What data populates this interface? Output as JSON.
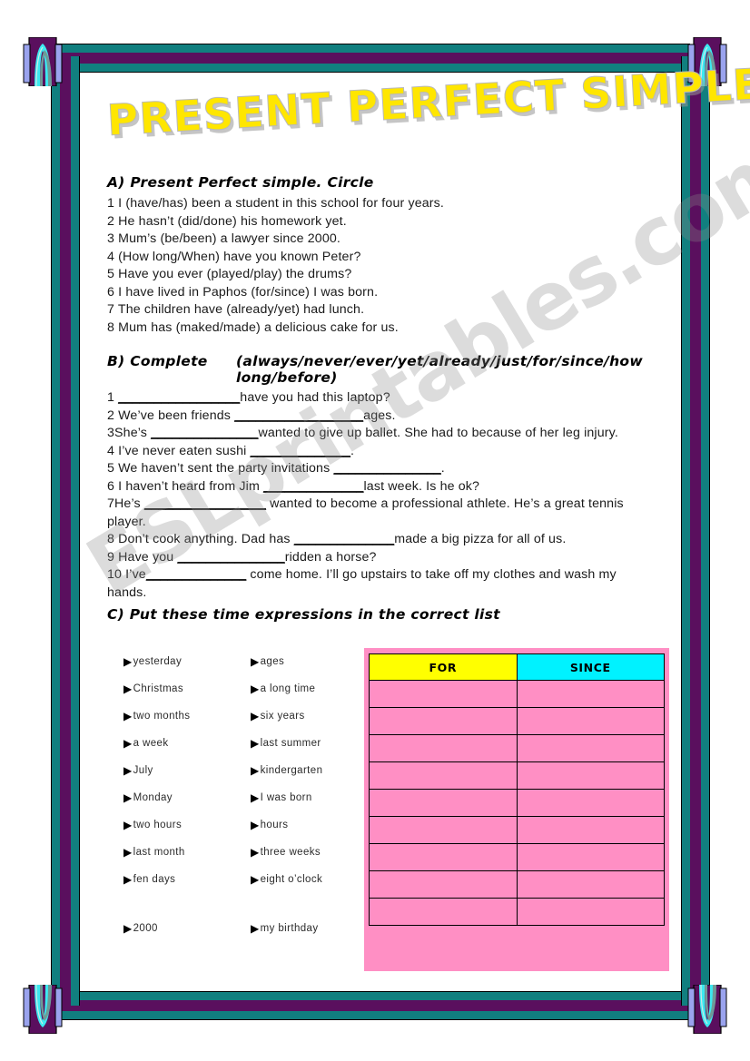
{
  "title": "PRESENT PERFECT SIMPLE",
  "watermark": "ESLprintables.com",
  "section_a": {
    "heading": "A) Present Perfect simple. Circle",
    "items": [
      "1 I (have/has) been a student in this school for four years.",
      "2 He hasn’t (did/done) his homework yet.",
      "3 Mum’s (be/been) a lawyer since 2000.",
      "4 (How long/When) have you known Peter?",
      "5 Have you ever (played/play) the drums?",
      "6 I have lived in Paphos (for/since) I was born.",
      "7 The children have (already/yet) had lunch.",
      "8  Mum has (maked/made) a delicious cake for us."
    ]
  },
  "section_b": {
    "heading": "B) Complete",
    "word_bank": "(always/never/ever/yet/already/just/for/since/how long/before)",
    "items": [
      {
        "pre": "1 ",
        "blank": "_________________",
        "post": "have you had this laptop?"
      },
      {
        "pre": "2 We’ve been friends ",
        "blank": "__________________",
        "post": "ages."
      },
      {
        "pre": "3She’s ",
        "blank": "_______________",
        "post": "wanted to give up ballet. She had to because of her leg injury."
      },
      {
        "pre": "4 I’ve never eaten sushi ",
        "blank": "______________",
        "post": "."
      },
      {
        "pre": "5 We haven’t sent the party invitations ",
        "blank": "_______________",
        "post": "."
      },
      {
        "pre": "6 I haven’t heard from Jim ",
        "blank": "______________",
        "post": "last week. Is he ok?"
      },
      {
        "pre": "7He’s ",
        "blank": "_________________",
        "post": " wanted to become a professional athlete. He’s a great tennis player."
      },
      {
        "pre": "8 Don’t cook anything. Dad has ",
        "blank": "______________",
        "post": "made a big pizza for all of us."
      },
      {
        "pre": "9 Have you ",
        "blank": "_______________",
        "post": "ridden a horse?"
      },
      {
        "pre": "10 I’ve",
        "blank": "______________",
        "post": " come home. I’ll go upstairs to take off my clothes and wash my hands."
      }
    ]
  },
  "section_c": {
    "heading": "C) Put these time expressions in the correct list",
    "bullet_icon": "▶",
    "expressions_left": [
      "yesterday",
      "Christmas",
      "two months",
      "a week",
      "July",
      "Monday",
      "two hours",
      "last month",
      "fen days",
      "2000"
    ],
    "expressions_right": [
      "ages",
      "a long time",
      "six years",
      "last summer",
      "kindergarten",
      "I was born",
      "hours",
      "three weeks",
      "eight o’clock",
      "my birthday"
    ],
    "table": {
      "headers": [
        "FOR",
        "SINCE"
      ],
      "header_colors": [
        "#ffff00",
        "#00f2ff"
      ],
      "row_color": "#ff8fc4",
      "empty_rows": 9
    }
  },
  "frame": {
    "teal": "#117f7f",
    "purple": "#5a0f5e",
    "cyan": "#3ce8f0",
    "periwinkle": "#9aa3ee",
    "sage": "#6f9a97"
  }
}
